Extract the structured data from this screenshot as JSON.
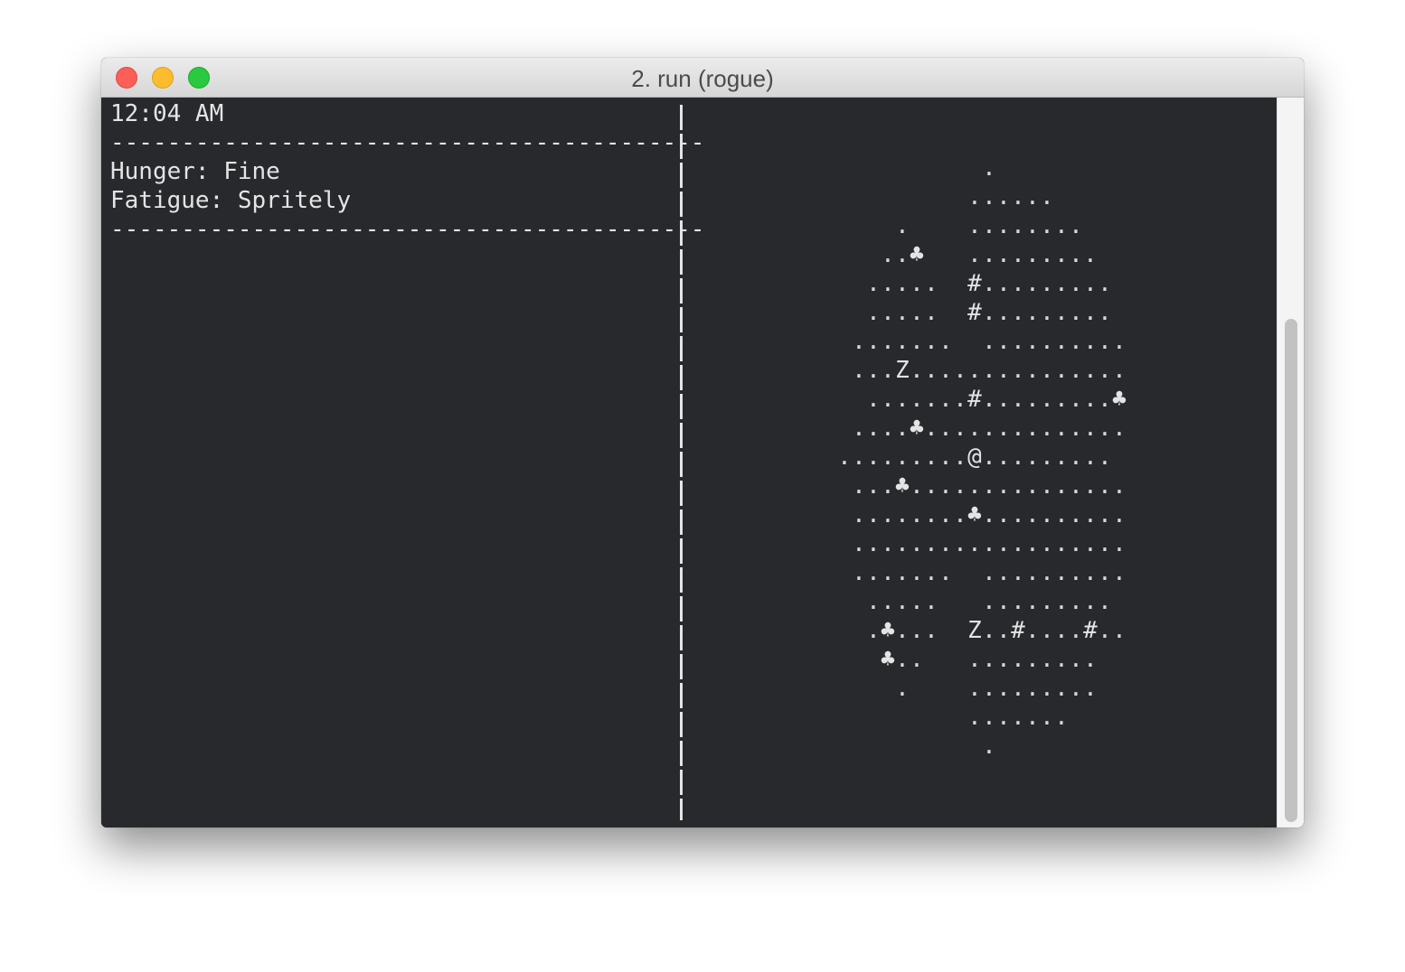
{
  "window": {
    "title": "2. run (rogue)"
  },
  "status": {
    "clock": "12:04 AM",
    "rule": "------------------------------------------",
    "hunger": "Hunger: Fine",
    "fatigue": "Fatigue: Spritely"
  },
  "map": {
    "rows": [
      "          .          ",
      "         ......      ",
      "    .    ........    ",
      "   ..♣   .........   ",
      "  .....  #.........  ",
      "  .....  #.........  ",
      " .......  .......... ",
      " ...Z............... ",
      "  .......#.........♣ ",
      " ....♣.............. ",
      ".........@.........",
      " ...♣............... ",
      " ........♣.......... ",
      " ................... ",
      " .......  .......... ",
      "  .....   .........  ",
      "  .♣...  Z..#....#.. ",
      "   ♣..   .........   ",
      "    .    .........   ",
      "         .......     ",
      "          .          "
    ],
    "player_glyph": "@",
    "legend_glyphs": [
      "♣",
      "#",
      "Z",
      "."
    ]
  },
  "scrollbar": {
    "visible_fraction": 0.7,
    "position_fraction": 1.0
  },
  "colors": {
    "terminal_bg": "#28292d",
    "terminal_fg": "#e4e4e4",
    "close": "#fc5f57",
    "minimize": "#fdbc2e",
    "zoom": "#29c940"
  }
}
